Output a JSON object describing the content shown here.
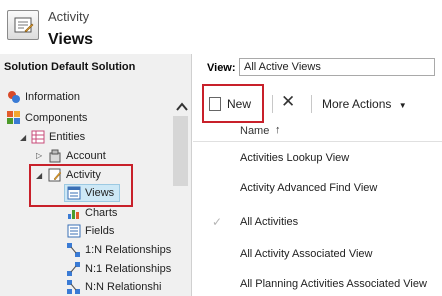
{
  "header": {
    "entity_name": "Activity",
    "section": "Views"
  },
  "solution": {
    "title": "Solution Default Solution"
  },
  "tree": {
    "information": "Information",
    "components": "Components",
    "entities": "Entities",
    "account": "Account",
    "activity": "Activity",
    "views": "Views",
    "charts": "Charts",
    "fields": "Fields",
    "rel_1n": "1:N Relationships",
    "rel_n1": "N:1 Relationships",
    "rel_nn": "N:N Relationshi"
  },
  "view_selector": {
    "label": "View:",
    "value": "All Active Views"
  },
  "toolbar": {
    "new_label": "New",
    "more_actions_label": "More Actions"
  },
  "grid": {
    "column_header": "Name",
    "sort_indicator": "↑",
    "rows": [
      "Activities Lookup View",
      "Activity Advanced Find View",
      "All Activities",
      "All Activity Associated View",
      "All Planning Activities Associated View"
    ]
  },
  "colors": {
    "highlight_box": "#c8202a",
    "selection": "#cde8f6"
  }
}
